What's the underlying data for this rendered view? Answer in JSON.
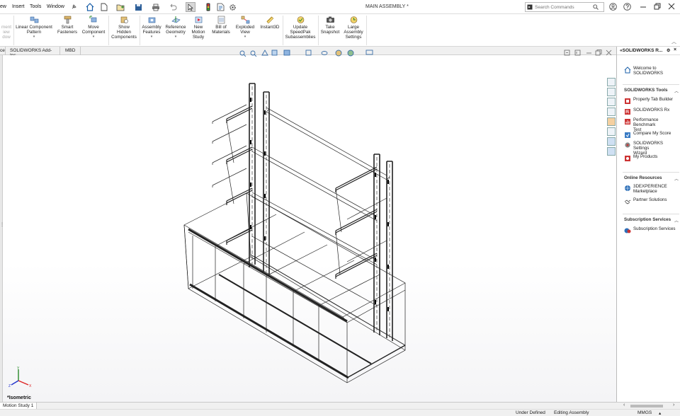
{
  "menu": {
    "items": [
      "ew",
      "Insert",
      "Tools",
      "Window"
    ],
    "doc_title": "MAIN ASSEMBLY *",
    "search_placeholder": "Search Commands"
  },
  "commands": {
    "partial_first": [
      "ment",
      "iew",
      "dow"
    ],
    "linear_pattern": "Linear Component\nPattern",
    "smart_fasteners": "Smart\nFasteners",
    "move_component": "Move\nComponent",
    "show_hidden": "Show\nHidden\nComponents",
    "assembly_features": "Assembly\nFeatures",
    "reference_geometry": "Reference\nGeometry",
    "new_motion_study": "New\nMotion\nStudy",
    "bill_of_materials": "Bill of\nMaterials",
    "exploded_view": "Exploded\nView",
    "instant3d": "Instant3D",
    "update_speedpak": "Update\nSpeedPak\nSubassemblies",
    "take_snapshot": "Take\nSnapshot",
    "large_assembly": "Large\nAssembly\nSettings"
  },
  "tabs": [
    "ce",
    "SOLIDWORKS Add-Ins",
    "MBD"
  ],
  "viewport": {
    "view_label": "*Isometric"
  },
  "taskpane": {
    "title": "SOLIDWORKS R...",
    "welcome": "Welcome to\nSOLIDWORKS",
    "tools_header": "SOLIDWORKS Tools",
    "tools": [
      "Property Tab Builder",
      "SOLIDWORKS Rx",
      "Performance Benchmark\nTest",
      "Compare My Score",
      "SOLIDWORKS Settings\nWizard",
      "My Products"
    ],
    "online_header": "Online Resources",
    "online": [
      "3DEXPERIENCE\nMarketplace",
      "Partner Solutions"
    ],
    "subscription_header": "Subscription Services",
    "subscription": [
      "Subscription Services"
    ]
  },
  "motion": {
    "tab_label": "Motion Study 1"
  },
  "status": {
    "under_defined": "Under Defined",
    "editing": "Editing Assembly",
    "units": "MMGS"
  },
  "colors": {
    "accent": "#1a5fa8",
    "wire": "#222222"
  }
}
